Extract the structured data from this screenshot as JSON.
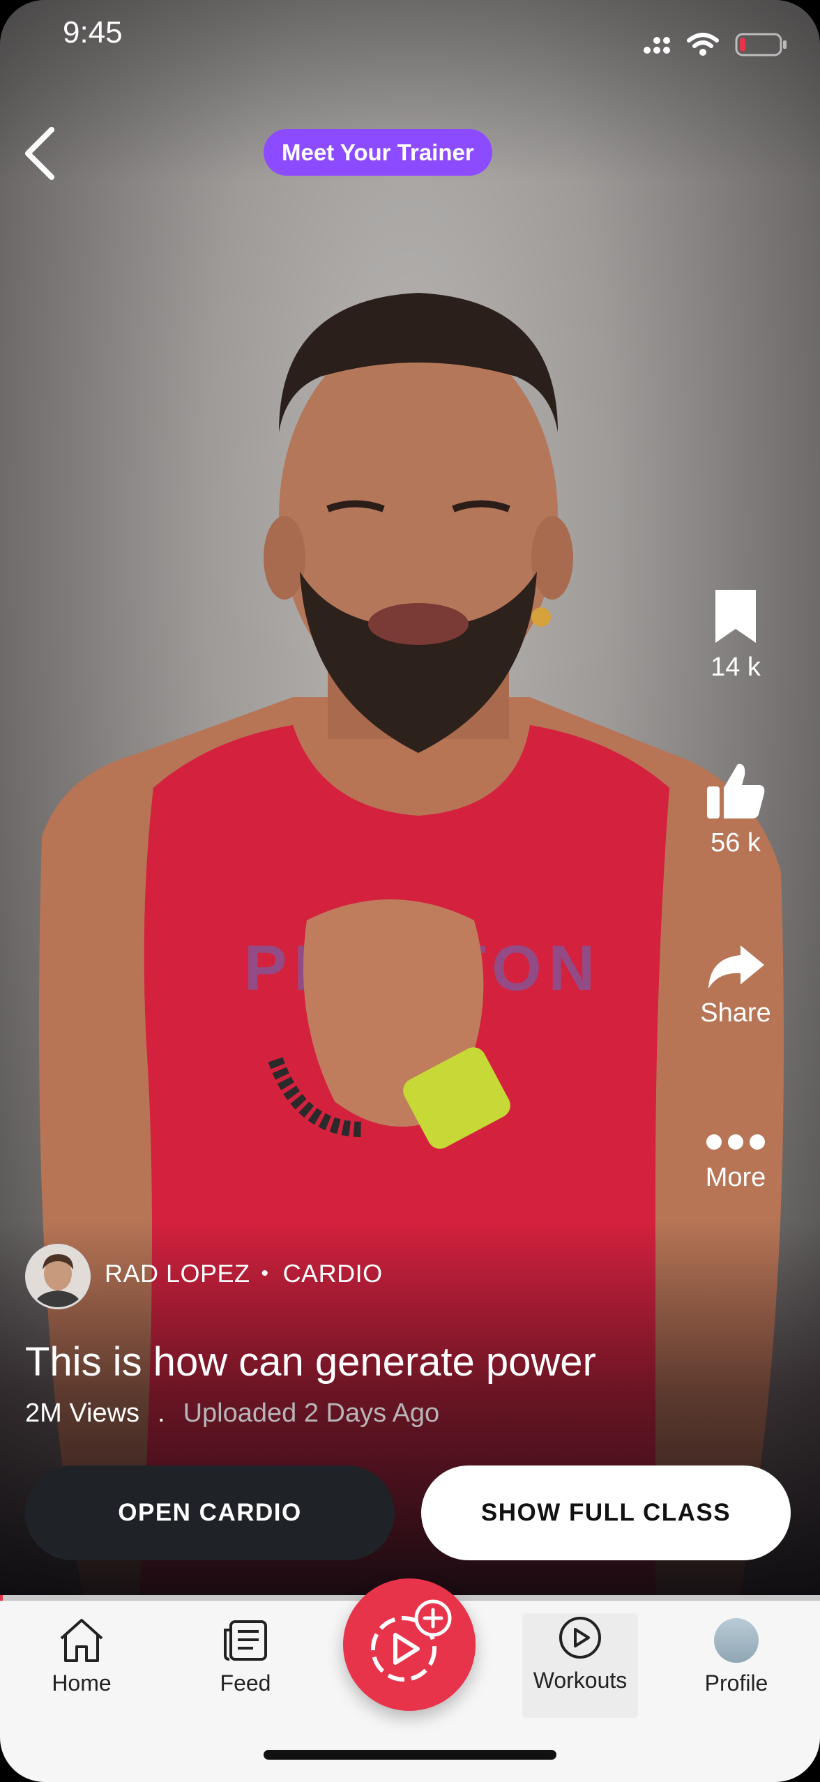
{
  "status_bar": {
    "time": "9:45",
    "battery_level": 0.15,
    "battery_color": "#e8344a"
  },
  "header": {
    "trainer_pill": "Meet Your Trainer",
    "pill_color": "#8d4bff"
  },
  "video": {
    "shirt_text": "PELOTON",
    "shirt_color": "#d4213e"
  },
  "actions": {
    "bookmark_count": "14 k",
    "like_count": "56 k",
    "share_label": "Share",
    "more_label": "More"
  },
  "meta": {
    "trainer_name": "RAD LOPEZ",
    "separator": "•",
    "category": "CARDIO",
    "title": "This is how can generate power",
    "views": "2M Views",
    "stats_separator": ".",
    "uploaded": "Uploaded 2 Days Ago"
  },
  "buttons": {
    "open_cardio": "OPEN CARDIO",
    "show_full_class": "SHOW FULL CLASS"
  },
  "progress": {
    "fraction": 0.003,
    "color": "#e8344a"
  },
  "nav": {
    "items": [
      {
        "label": "Home",
        "icon": "home-icon"
      },
      {
        "label": "Feed",
        "icon": "feed-icon"
      },
      {
        "label": "Workouts",
        "icon": "play-circle-icon"
      },
      {
        "label": "Profile",
        "icon": "profile-avatar"
      }
    ],
    "create_icon": "create-video-plus-icon",
    "create_color": "#e8344a"
  }
}
